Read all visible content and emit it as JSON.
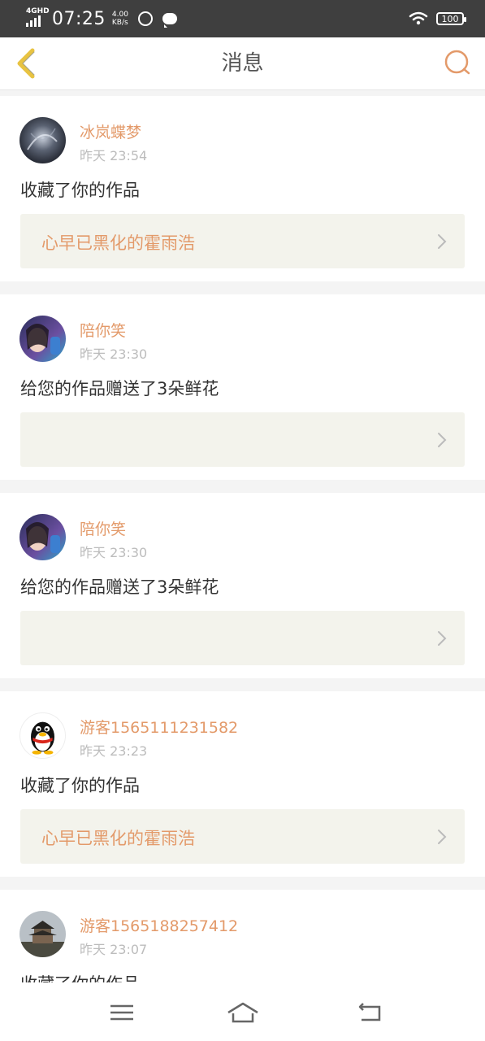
{
  "status_bar": {
    "network": "4GHD",
    "time": "07:25",
    "speed_value": "4.00",
    "speed_unit": "KB/s",
    "battery": "100"
  },
  "header": {
    "title": "消息"
  },
  "messages": [
    {
      "username": "冰岚蝶梦",
      "time": "昨天 23:54",
      "action": "收藏了你的作品",
      "work_title": "心早已黑化的霍雨浩",
      "avatar": "avatar-dark-abstract"
    },
    {
      "username": "陪你笑",
      "time": "昨天 23:30",
      "action": "给您的作品赠送了3朵鲜花",
      "work_title": "",
      "avatar": "avatar-girl-photo"
    },
    {
      "username": "陪你笑",
      "time": "昨天 23:30",
      "action": "给您的作品赠送了3朵鲜花",
      "work_title": "",
      "avatar": "avatar-girl-photo"
    },
    {
      "username": "游客1565111231582",
      "time": "昨天 23:23",
      "action": "收藏了你的作品",
      "work_title": "心早已黑化的霍雨浩",
      "avatar": "avatar-qq-penguin"
    },
    {
      "username": "游客1565188257412",
      "time": "昨天 23:07",
      "action": "收藏了你的作品",
      "work_title": "",
      "avatar": "avatar-pagoda-photo"
    }
  ],
  "colors": {
    "accent": "#e39a6a",
    "back_arrow": "#e8c342"
  }
}
